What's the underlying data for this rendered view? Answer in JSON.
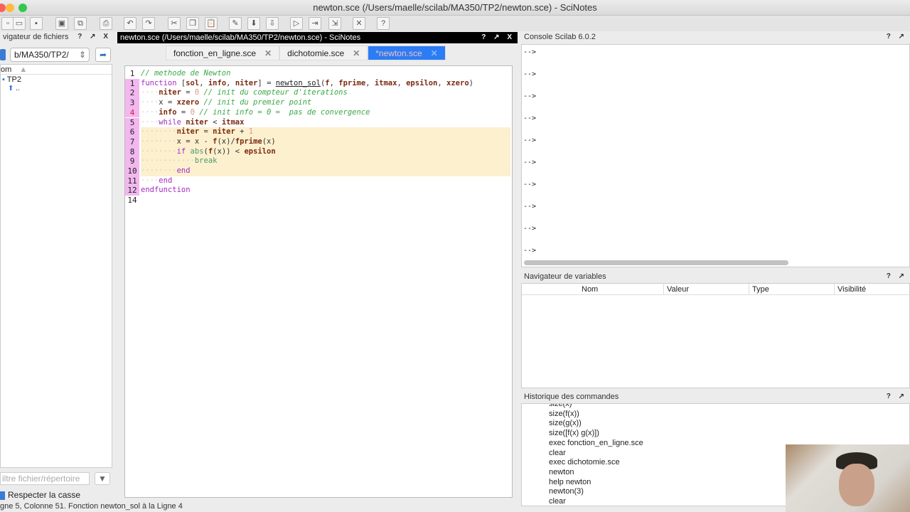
{
  "window": {
    "title": "newton.sce (/Users/maelle/scilab/MA350/TP2/newton.sce) - SciNotes",
    "colors": {
      "close": "#fc605c",
      "min": "#fdbc40",
      "max": "#34c84a"
    }
  },
  "toolbar": {
    "icons": [
      "new-file-icon",
      "open-file-icon",
      "open-folder-icon",
      "save-icon",
      "save-as-icon",
      "print-icon",
      "undo-icon",
      "redo-icon",
      "cut-icon",
      "copy-icon",
      "paste-icon",
      "edit-icon",
      "load-icon",
      "execute-icon",
      "run-icon",
      "run-with-echo-icon",
      "run-till-cursor-icon",
      "tools-icon",
      "help-icon"
    ],
    "glyphs": [
      "▫",
      "▭",
      "▪",
      "▣",
      "⧉",
      "⎙",
      "↶",
      "↷",
      "✂",
      "❐",
      "📋",
      "✎",
      "⬇",
      "⇩",
      "▷",
      "⇥",
      "⇲",
      "✕",
      "?"
    ]
  },
  "file_browser": {
    "title": "vigateur de fichiers",
    "path": "b/MA350/TP2/",
    "column": "om",
    "tree": [
      "TP2",
      ".."
    ],
    "filter_placeholder": "iltre fichier/répertoire",
    "case_label": "Respecter la casse",
    "panel_buttons": "? ↗ X"
  },
  "editor": {
    "title": "newton.sce (/Users/maelle/scilab/MA350/TP2/newton.sce) - SciNotes",
    "panel_buttons": "? ↗ X",
    "tabs": [
      {
        "label": "fonction_en_ligne.sce",
        "active": false
      },
      {
        "label": "dichotomie.sce",
        "active": false
      },
      {
        "label": "*newton.sce",
        "active": true
      }
    ],
    "lines": [
      {
        "num": "1",
        "mod": false,
        "hl": false,
        "tokens": [
          [
            "// methode de Newton",
            "com"
          ]
        ]
      },
      {
        "num": "1",
        "mod": true,
        "hl": false,
        "tokens": [
          [
            "function ",
            "kw"
          ],
          [
            "[",
            "op"
          ],
          [
            "sol",
            "var"
          ],
          [
            ", ",
            "op"
          ],
          [
            "info",
            "var"
          ],
          [
            ", ",
            "op"
          ],
          [
            "niter",
            "var"
          ],
          [
            "] = ",
            "op"
          ],
          [
            "newton_sol",
            "fn"
          ],
          [
            "(",
            "op"
          ],
          [
            "f",
            "var"
          ],
          [
            ", ",
            "op"
          ],
          [
            "fprime",
            "var"
          ],
          [
            ", ",
            "op"
          ],
          [
            "itmax",
            "var"
          ],
          [
            ", ",
            "op"
          ],
          [
            "epsilon",
            "var"
          ],
          [
            ", ",
            "op"
          ],
          [
            "xzero",
            "var"
          ],
          [
            ")",
            "op"
          ]
        ]
      },
      {
        "num": "2",
        "mod": true,
        "hl": false,
        "tokens": [
          [
            "    ",
            "ws"
          ],
          [
            "niter",
            "var"
          ],
          [
            " = ",
            "op"
          ],
          [
            "0",
            "num"
          ],
          [
            " // init du compteur d'iterations",
            "com"
          ]
        ]
      },
      {
        "num": "3",
        "mod": true,
        "hl": false,
        "tokens": [
          [
            "    ",
            "ws"
          ],
          [
            "x = ",
            "op"
          ],
          [
            "xzero",
            "var"
          ],
          [
            " // init du premier point",
            "com"
          ]
        ]
      },
      {
        "num": "4",
        "mod": true,
        "red": true,
        "hl": false,
        "tokens": [
          [
            "    ",
            "ws"
          ],
          [
            "info",
            "var"
          ],
          [
            " = ",
            "op"
          ],
          [
            "0",
            "num"
          ],
          [
            " // init info = 0 =  pas de convergence",
            "com"
          ]
        ]
      },
      {
        "num": "5",
        "mod": true,
        "hl": false,
        "tokens": [
          [
            "    ",
            "ws"
          ],
          [
            "while ",
            "kw"
          ],
          [
            "niter",
            "var"
          ],
          [
            " < ",
            "op"
          ],
          [
            "itmax",
            "var"
          ]
        ]
      },
      {
        "num": "6",
        "mod": true,
        "hl": true,
        "tokens": [
          [
            "        ",
            "ws"
          ],
          [
            "niter",
            "var"
          ],
          [
            " = ",
            "op"
          ],
          [
            "niter",
            "var"
          ],
          [
            " + ",
            "op"
          ],
          [
            "1",
            "num"
          ]
        ]
      },
      {
        "num": "7",
        "mod": true,
        "hl": true,
        "tokens": [
          [
            "        ",
            "ws"
          ],
          [
            "x = x - ",
            "op"
          ],
          [
            "f",
            "var"
          ],
          [
            "(x)/",
            "op"
          ],
          [
            "fprime",
            "var"
          ],
          [
            "(x)",
            "op"
          ]
        ]
      },
      {
        "num": "8",
        "mod": true,
        "hl": true,
        "tokens": [
          [
            "        ",
            "ws"
          ],
          [
            "if ",
            "kw"
          ],
          [
            "abs",
            "bi"
          ],
          [
            "(",
            "op"
          ],
          [
            "f",
            "var"
          ],
          [
            "(x)) < ",
            "op"
          ],
          [
            "epsilon",
            "var"
          ]
        ]
      },
      {
        "num": "9",
        "mod": true,
        "hl": true,
        "tokens": [
          [
            "            ",
            "ws"
          ],
          [
            "break",
            "bi"
          ]
        ]
      },
      {
        "num": "10",
        "mod": true,
        "hl": true,
        "tokens": [
          [
            "        ",
            "ws"
          ],
          [
            "end",
            "kw"
          ]
        ]
      },
      {
        "num": "11",
        "mod": true,
        "hl": false,
        "tokens": [
          [
            "    ",
            "ws"
          ],
          [
            "end",
            "kw"
          ]
        ]
      },
      {
        "num": "12",
        "mod": true,
        "hl": false,
        "tokens": [
          [
            "endfunction",
            "kw"
          ]
        ]
      },
      {
        "num": "14",
        "mod": false,
        "hl": false,
        "tokens": []
      }
    ]
  },
  "console": {
    "title": "Console Scilab 6.0.2",
    "panel_buttons": "? ↗",
    "prompts": [
      "-->",
      "-->",
      "-->",
      "-->",
      "-->",
      "-->",
      "-->",
      "-->",
      "-->",
      "-->"
    ]
  },
  "variables": {
    "title": "Navigateur de variables",
    "panel_buttons": "? ↗",
    "columns": [
      "Nom",
      "Valeur",
      "Type",
      "Visibilité"
    ]
  },
  "history": {
    "title": "Historique des commandes",
    "panel_buttons": "? ↗",
    "items": [
      "size(x)",
      "size(f(x))",
      "size(g(x))",
      "size([f(x) g(x)])",
      "exec fonction_en_ligne.sce",
      "clear",
      "exec dichotomie.sce",
      "newton",
      "help newton",
      "newton(3)",
      "clear"
    ]
  },
  "status": {
    "text": "gne 5, Colonne 51. Fonction newton_sol à la Ligne 4"
  }
}
